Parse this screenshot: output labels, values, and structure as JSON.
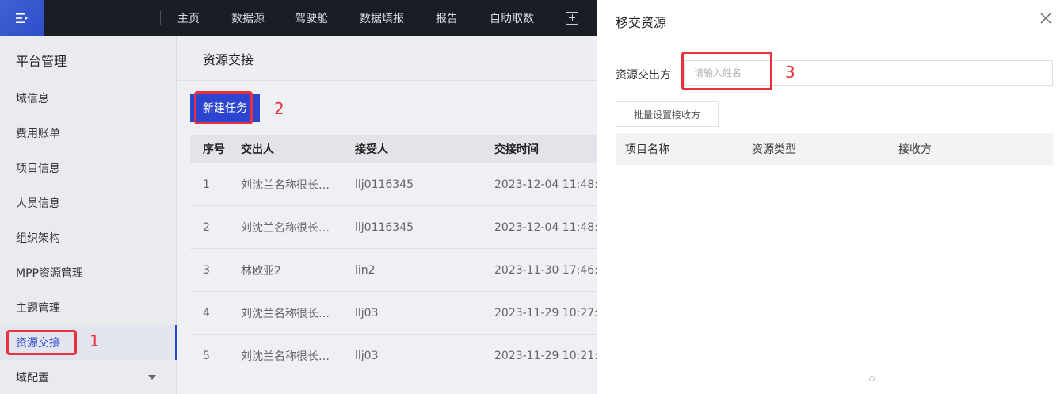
{
  "topbar": {
    "nav": [
      "主页",
      "数据源",
      "驾驶舱",
      "数据填报",
      "报告",
      "自助取数"
    ],
    "colors": {
      "bg": "#1a1d24",
      "menu_button": "#2d4ec7"
    }
  },
  "sidebar": {
    "title": "平台管理",
    "items": [
      {
        "label": "域信息"
      },
      {
        "label": "费用账单"
      },
      {
        "label": "项目信息"
      },
      {
        "label": "人员信息"
      },
      {
        "label": "组织架构"
      },
      {
        "label": "MPP资源管理"
      },
      {
        "label": "主题管理"
      },
      {
        "label": "资源交接",
        "active": true
      },
      {
        "label": "域配置",
        "expandable": true
      }
    ]
  },
  "main": {
    "title": "资源交接",
    "new_task_label": "新建任务",
    "table": {
      "headers": [
        "序号",
        "交出人",
        "接受人",
        "交接时间"
      ],
      "rows": [
        [
          "1",
          "刘沈兰名称很长…",
          "llj0116345",
          "2023-12-04 11:48:"
        ],
        [
          "2",
          "刘沈兰名称很长…",
          "llj0116345",
          "2023-12-04 11:48:"
        ],
        [
          "3",
          "林欧亚2",
          "lin2",
          "2023-11-30 17:46:"
        ],
        [
          "4",
          "刘沈兰名称很长…",
          "llj03",
          "2023-11-29 10:27:"
        ],
        [
          "5",
          "刘沈兰名称很长…",
          "llj03",
          "2023-11-29 10:21:"
        ]
      ]
    }
  },
  "drawer": {
    "title": "移交资源",
    "field_label": "资源交出方",
    "input_placeholder": "请输入姓名",
    "input_value": "",
    "batch_button_label": "批量设置接收方",
    "table_headers": [
      "项目名称",
      "资源类型",
      "接收方"
    ]
  },
  "annotations": [
    "1",
    "2",
    "3"
  ],
  "colors": {
    "accent": "#2b45d1",
    "annotation": "#e8313d"
  }
}
